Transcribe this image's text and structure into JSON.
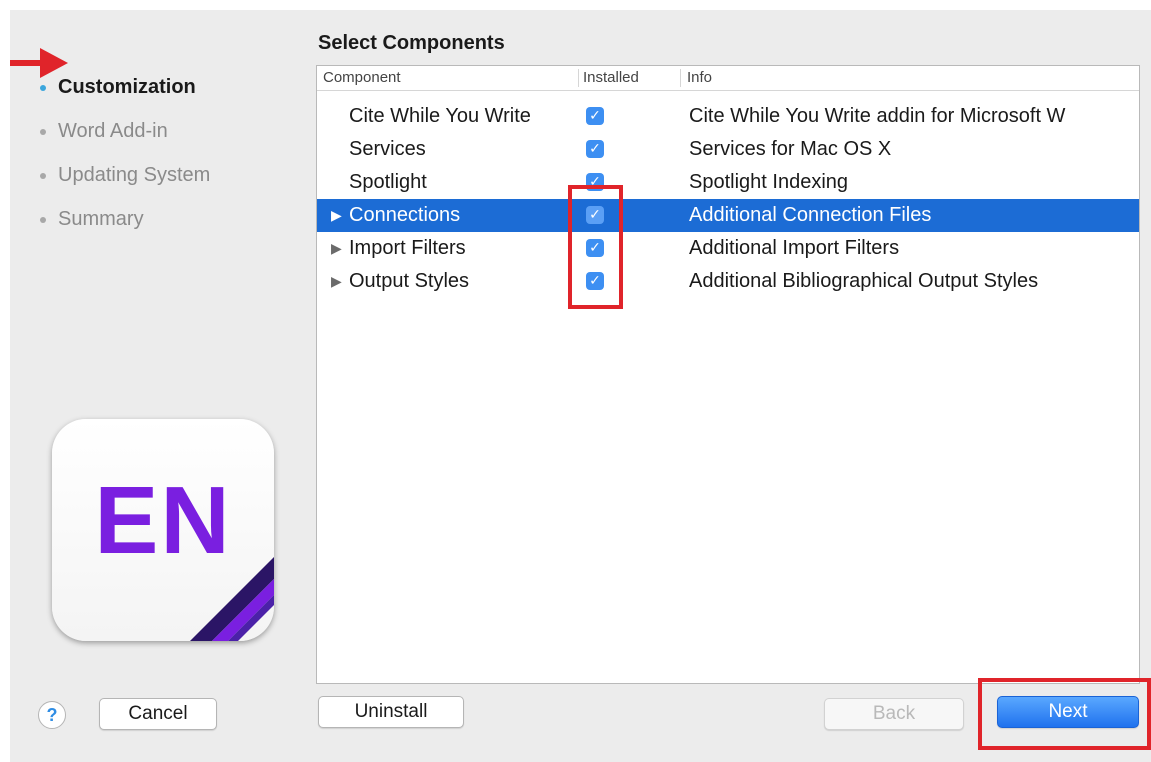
{
  "sidebar": {
    "steps": [
      {
        "label": "Customization",
        "active": true
      },
      {
        "label": "Word Add-in",
        "active": false
      },
      {
        "label": "Updating System",
        "active": false
      },
      {
        "label": "Summary",
        "active": false
      }
    ],
    "logo_text": "EN",
    "help_label": "?"
  },
  "main": {
    "title": "Select Components",
    "table": {
      "headers": {
        "component": "Component",
        "installed": "Installed",
        "info": "Info"
      },
      "rows": [
        {
          "component": "Cite While You Write",
          "expandable": false,
          "installed": true,
          "info": "Cite While You Write addin for Microsoft W",
          "selected": false
        },
        {
          "component": "Services",
          "expandable": false,
          "installed": true,
          "info": "Services for Mac OS X",
          "selected": false
        },
        {
          "component": "Spotlight",
          "expandable": false,
          "installed": true,
          "info": "Spotlight Indexing",
          "selected": false
        },
        {
          "component": "Connections",
          "expandable": true,
          "installed": true,
          "info": "Additional Connection Files",
          "selected": true
        },
        {
          "component": "Import Filters",
          "expandable": true,
          "installed": true,
          "info": "Additional Import Filters",
          "selected": false
        },
        {
          "component": "Output Styles",
          "expandable": true,
          "installed": true,
          "info": "Additional Bibliographical Output Styles",
          "selected": false
        }
      ]
    }
  },
  "buttons": {
    "cancel": "Cancel",
    "uninstall": "Uninstall",
    "back": "Back",
    "next": "Next"
  },
  "icons": {
    "checkmark": "✓",
    "disclosure": "▶"
  },
  "colors": {
    "selection": "#1c6cd5",
    "highlight": "#e0242a",
    "accent": "#3ba6dc",
    "logo": "#7a1fe0"
  }
}
